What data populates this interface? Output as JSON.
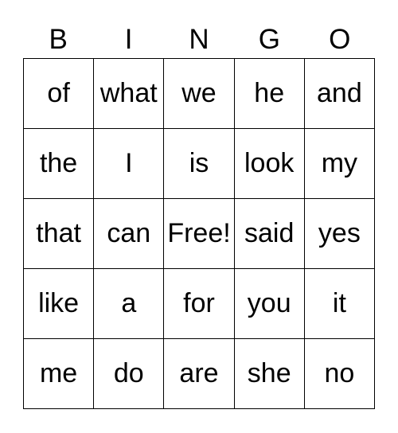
{
  "header": [
    "B",
    "I",
    "N",
    "G",
    "O"
  ],
  "cells": [
    [
      "of",
      "what",
      "we",
      "he",
      "and"
    ],
    [
      "the",
      "I",
      "is",
      "look",
      "my"
    ],
    [
      "that",
      "can",
      "Free!",
      "said",
      "yes"
    ],
    [
      "like",
      "a",
      "for",
      "you",
      "it"
    ],
    [
      "me",
      "do",
      "are",
      "she",
      "no"
    ]
  ]
}
